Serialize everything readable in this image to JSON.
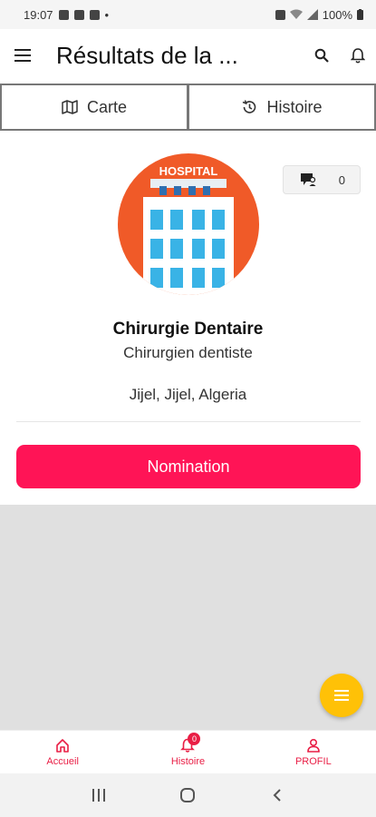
{
  "status_bar": {
    "time": "19:07",
    "battery": "100%",
    "icons": [
      "image-icon",
      "facebook-icon",
      "facebook-icon",
      "dot-icon",
      "alarm-icon",
      "wifi-icon",
      "signal-icon",
      "battery-icon"
    ]
  },
  "app_bar": {
    "title": "Résultats de la ...",
    "left_icon": "menu-icon",
    "actions": [
      "search-icon",
      "bell-icon"
    ]
  },
  "tabs": [
    {
      "label": "Carte",
      "icon": "map-icon"
    },
    {
      "label": "Histoire",
      "icon": "history-icon"
    }
  ],
  "profile": {
    "avatar_sign": "HOSPITAL",
    "counter_value": "0",
    "counter_icon": "comment-user-icon",
    "name": "Chirurgie Dentaire",
    "specialty": "Chirurgien dentiste",
    "location": "Jijel, Jijel, Algeria"
  },
  "actions": {
    "nomination_label": "Nomination"
  },
  "fab": {
    "icon": "list-icon"
  },
  "bottom_nav": {
    "items": [
      {
        "label": "Accueil",
        "icon": "home-icon"
      },
      {
        "label": "Histoire",
        "icon": "bell-icon",
        "badge": "0"
      },
      {
        "label": "PROFIL",
        "icon": "user-icon"
      }
    ]
  },
  "system_nav": [
    "recents-icon",
    "home-circle-icon",
    "back-icon"
  ],
  "colors": {
    "accent": "#ff1456",
    "nav_active": "#e91e45",
    "fab": "#ffc107",
    "avatar_bg": "#f05a28",
    "building_blue": "#39b3e6"
  }
}
